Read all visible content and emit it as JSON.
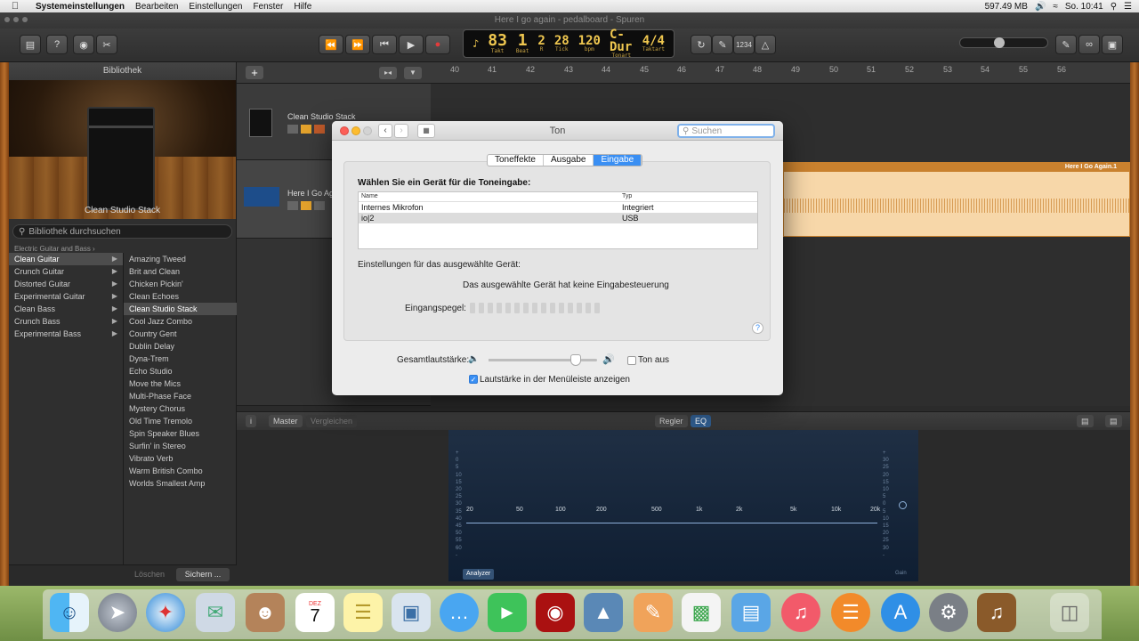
{
  "menubar": {
    "app": "Systemeinstellungen",
    "items": [
      "Bearbeiten",
      "Einstellungen",
      "Fenster",
      "Hilfe"
    ],
    "memory": "597.49 MB",
    "clock": "So. 10:41"
  },
  "window_title": "Here I go again - pedalboard - Spuren",
  "lcd": {
    "bar": "83",
    "bar_label": "Takt",
    "beat": "1",
    "beat_label": "Beat",
    "r": "2",
    "r_label": "R",
    "tick": "28",
    "tick_label": "Tick",
    "bpm": "120",
    "bpm_label": "bpm",
    "key": "C-Dur",
    "key_label": "Tonart",
    "sig": "4/4",
    "sig_label": "Taktart"
  },
  "toolbar": {
    "count_in": "1234"
  },
  "library": {
    "title": "Bibliothek",
    "amp_caption": "Clean Studio Stack",
    "search_placeholder": "Bibliothek durchsuchen",
    "path": "Electric Guitar and Bass",
    "categories": [
      "Clean Guitar",
      "Crunch Guitar",
      "Distorted Guitar",
      "Experimental Guitar",
      "Clean Bass",
      "Crunch Bass",
      "Experimental Bass"
    ],
    "presets": [
      "Amazing Tweed",
      "Brit and Clean",
      "Chicken Pickin'",
      "Clean Echoes",
      "Clean Studio Stack",
      "Cool Jazz Combo",
      "Country Gent",
      "Dublin Delay",
      "Dyna-Trem",
      "Echo Studio",
      "Move the Mics",
      "Multi-Phase Face",
      "Mystery Chorus",
      "Old Time Tremolo",
      "Spin Speaker Blues",
      "Surfin' in Stereo",
      "Vibrato Verb",
      "Warm British Combo",
      "Worlds Smallest Amp"
    ],
    "delete_label": "Löschen",
    "save_label": "Sichern ..."
  },
  "ruler": [
    "40",
    "41",
    "42",
    "43",
    "44",
    "45",
    "46",
    "47",
    "48",
    "49",
    "50",
    "51",
    "52",
    "53",
    "54",
    "55",
    "56"
  ],
  "tracks": [
    {
      "name": "Clean Studio Stack"
    },
    {
      "name": "Here I Go Ag"
    }
  ],
  "region": {
    "name": "Here I Go Again.1"
  },
  "smart": {
    "master": "Master",
    "compare": "Vergleichen",
    "tab_controls": "Regler",
    "tab_eq": "EQ",
    "analyzer": "Analyzer",
    "gain_label": "Gain",
    "db_left": [
      "+",
      "0",
      "5",
      "10",
      "15",
      "20",
      "25",
      "30",
      "35",
      "40",
      "45",
      "50",
      "55",
      "60",
      "-"
    ],
    "db_right": [
      "+",
      "30",
      "25",
      "20",
      "15",
      "10",
      "5",
      "0",
      "5",
      "10",
      "15",
      "20",
      "25",
      "30",
      "-"
    ],
    "freqs": [
      "20",
      "50",
      "100",
      "200",
      "500",
      "1k",
      "2k",
      "5k",
      "10k",
      "20k"
    ]
  },
  "dialog": {
    "title": "Ton",
    "search_placeholder": "Suchen",
    "tabs": [
      "Toneffekte",
      "Ausgabe",
      "Eingabe"
    ],
    "heading": "Wählen Sie ein Gerät für die Toneingabe:",
    "col_name": "Name",
    "col_type": "Typ",
    "devices": [
      {
        "name": "Internes Mikrofon",
        "type": "Integriert"
      },
      {
        "name": "io|2",
        "type": "USB"
      }
    ],
    "settings_label": "Einstellungen für das ausgewählte Gerät:",
    "no_control": "Das ausgewählte Gerät hat keine Eingabesteuerung",
    "input_level": "Eingangspegel:",
    "help": "?",
    "volume_label": "Gesamtlautstärke:",
    "volume_level": 0.82,
    "mute_label": "Ton aus",
    "menubar_label": "Lautstärke in der Menüleiste anzeigen",
    "menubar_checked": true
  },
  "dock": {
    "calendar_month": "DEZ",
    "calendar_day": "7",
    "apps": [
      "finder-icon",
      "launchpad-icon",
      "safari-icon",
      "mail-icon",
      "contacts-icon",
      "calendar-icon",
      "notes-icon",
      "preview-icon",
      "messages-icon",
      "facetime-icon",
      "photo-booth-icon",
      "iphoto-icon",
      "pages-icon",
      "numbers-icon",
      "keynote-icon",
      "itunes-icon",
      "ibooks-icon",
      "app-store-icon",
      "system-preferences-icon",
      "garageband-icon",
      "trash-icon"
    ]
  }
}
